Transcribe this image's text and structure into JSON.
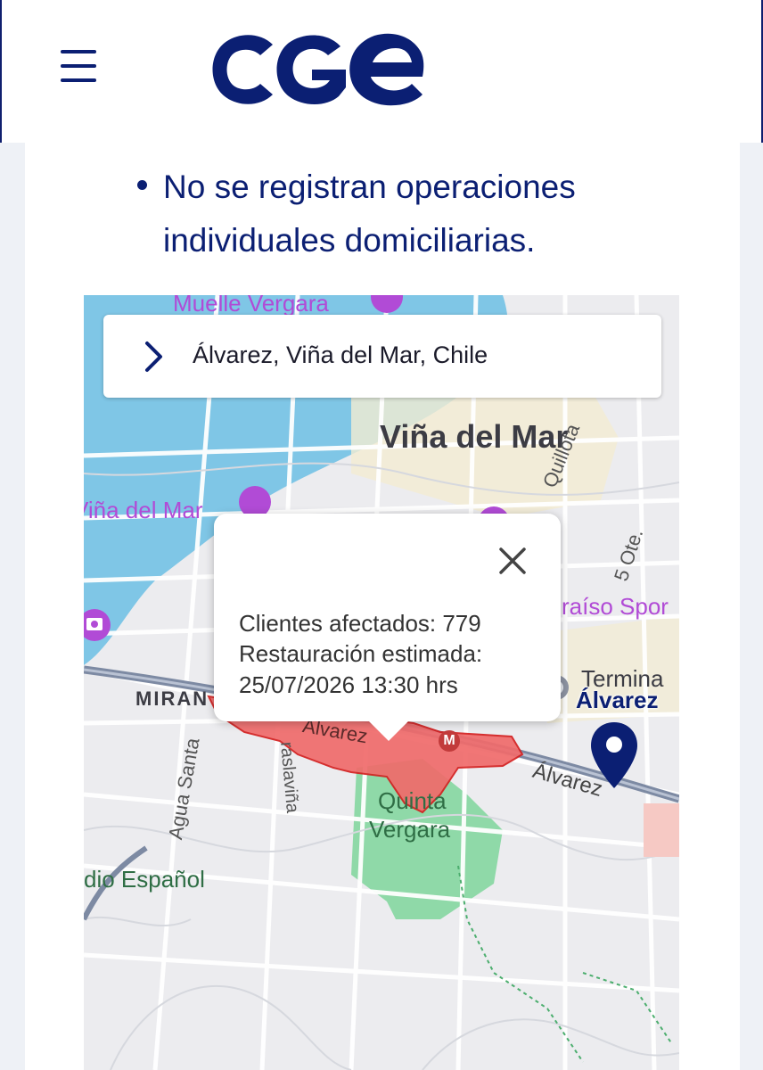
{
  "header": {
    "menu_icon": "hamburger-icon",
    "logo_text": "CGE",
    "brand_color": "#0b1f73"
  },
  "content": {
    "bullets": [
      "No se registran operaciones individuales domiciliarias."
    ]
  },
  "map": {
    "search": {
      "value": "Álvarez, Viña del Mar, Chile",
      "icon": "chevron-right-icon"
    },
    "labels": {
      "city": "Viña del Mar",
      "muelle": "Muelle Vergara",
      "station": "Viña del Mar",
      "quillota": "Quillota",
      "oriente": "5 Ote.",
      "sporting": "raíso Spor",
      "terminal": "Termina",
      "miramar": "MIRAN",
      "agua_santa": "Agua Santa",
      "traslavina": "raslaviña",
      "alvarez_street": "Álvarez",
      "alvarez_street_2": "Álvarez",
      "quinta_vergara_1": "Quinta",
      "quinta_vergara_2": "Vergara",
      "estadio": "dio Español",
      "metro": "M"
    },
    "popup": {
      "clients_line": "Clientes afectados: 779",
      "restoration_line": "Restauración estimada:",
      "datetime_line": "25/07/2026 13:30 hrs",
      "close_icon": "close-icon"
    },
    "pin": {
      "label": "Álvarez",
      "icon": "map-pin-icon"
    },
    "colors": {
      "outage_area": "#f06b6b",
      "outage_border": "#d41f1f",
      "water": "#7fc6e6",
      "park": "#8fd9a8",
      "poi": "#b14bd6"
    }
  }
}
